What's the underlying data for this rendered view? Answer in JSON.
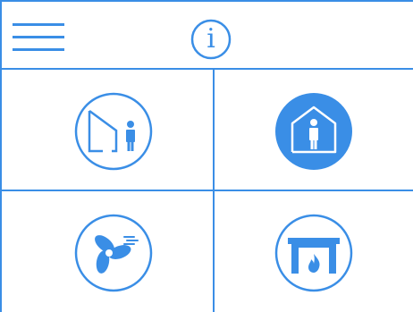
{
  "header": {
    "menu_icon": "hamburger-menu-icon",
    "info_icon": "info-icon",
    "info_glyph": "i"
  },
  "tiles": [
    {
      "id": "away",
      "icon": "away-mode-icon",
      "active": false
    },
    {
      "id": "home",
      "icon": "home-mode-icon",
      "active": true
    },
    {
      "id": "ventilation",
      "icon": "fan-icon",
      "active": false
    },
    {
      "id": "fireplace",
      "icon": "fireplace-icon",
      "active": false
    }
  ],
  "colors": {
    "accent": "#3a8ee6",
    "background": "#ffffff",
    "active_fill": "#3a8ee6",
    "active_icon": "#ffffff"
  }
}
